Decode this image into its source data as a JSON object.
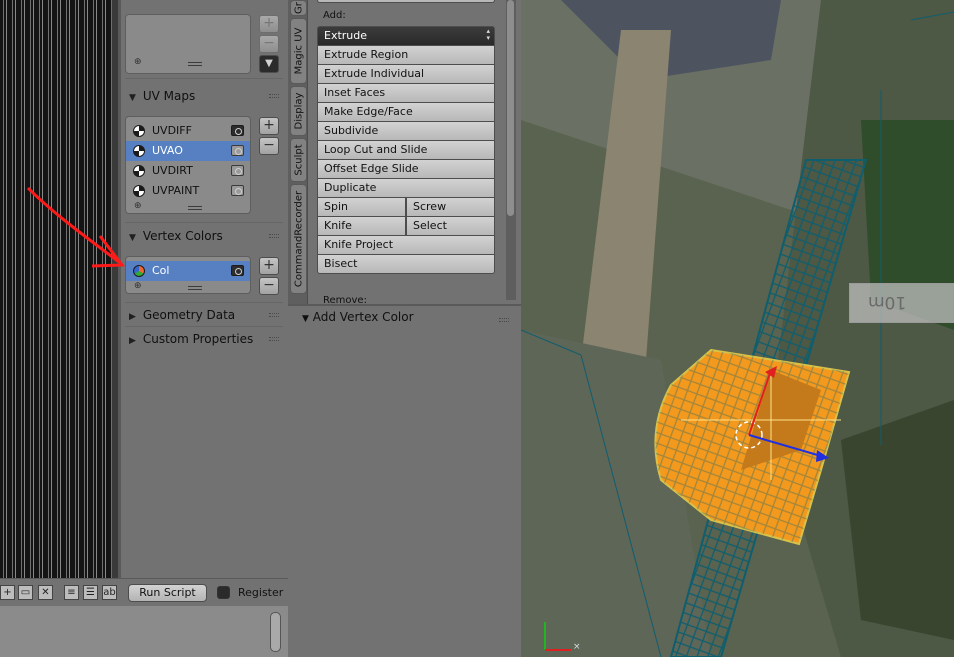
{
  "properties": {
    "uv_maps": {
      "title": "UV Maps",
      "items": [
        {
          "label": "UVDIFF",
          "selected": false
        },
        {
          "label": "UVAO",
          "selected": true
        },
        {
          "label": "UVDIRT",
          "selected": false
        },
        {
          "label": "UVPAINT",
          "selected": false
        }
      ]
    },
    "vertex_colors": {
      "title": "Vertex Colors",
      "items": [
        {
          "label": "Col",
          "selected": true
        }
      ]
    },
    "geometry_data": "Geometry Data",
    "custom_properties": "Custom Properties"
  },
  "tabs": [
    "Gr",
    "Magic UV",
    "Display",
    "Sculpt",
    "CommandRecorder"
  ],
  "tools": {
    "add_label": "Add:",
    "dropdown": "Extrude",
    "buttons": [
      "Extrude Region",
      "Extrude Individual",
      "Inset Faces",
      "Make Edge/Face",
      "Subdivide",
      "Loop Cut and Slide",
      "Offset Edge Slide",
      "Duplicate"
    ],
    "pairs": [
      [
        "Spin",
        "Screw"
      ],
      [
        "Knife",
        "Select"
      ]
    ],
    "after": [
      "Knife Project",
      "Bisect"
    ],
    "remove_label": "Remove:"
  },
  "redo_panel": {
    "title": "Add Vertex Color"
  },
  "text_editor": {
    "run_script": "Run Script",
    "register": "Register"
  },
  "viewport": {
    "ruler_label": "10m",
    "mesh_color": "#f39a1e",
    "wire_color": "#0f5e6e"
  },
  "colors": {
    "selection": "#5680c2",
    "annotation_arrow": "#ff1a1a"
  }
}
